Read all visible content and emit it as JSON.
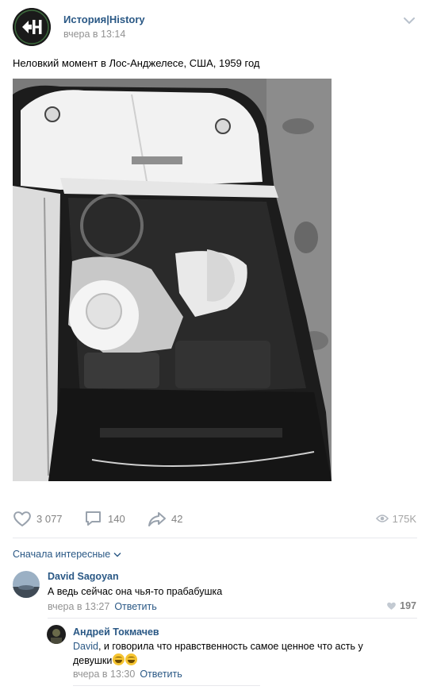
{
  "post": {
    "group_name": "История|History",
    "time": "вчера в 13:14",
    "text": "Неловкий момент в Лос-Анджелесе, США, 1959 год"
  },
  "actions": {
    "likes": "3 077",
    "comments": "140",
    "shares": "42",
    "views": "175K"
  },
  "comments": {
    "sort_label": "Сначала интересные",
    "items": [
      {
        "author": "David Sagoyan",
        "text": "А ведь сейчас она чья-то прабабушка",
        "time": "вчера в 13:27",
        "reply_label": "Ответить",
        "likes": "197"
      },
      {
        "author": "Андрей Токмачев",
        "mention": "David",
        "text_line1": ", и говорила что нравственность самое ценное что асть у",
        "text_line2": "девушки",
        "time": "вчера в 13:30",
        "reply_label": "Ответить"
      }
    ]
  },
  "icons": {
    "avatar_logo": "history-logo-icon",
    "menu": "chevron-down-icon",
    "like": "heart-icon",
    "comment": "comment-bubble-icon",
    "share": "share-arrow-icon",
    "views": "eye-icon",
    "emoji": "grinning-emoji-icon"
  },
  "colors": {
    "link": "#2a5885",
    "muted": "#939393",
    "divider": "#e7e8ec"
  }
}
